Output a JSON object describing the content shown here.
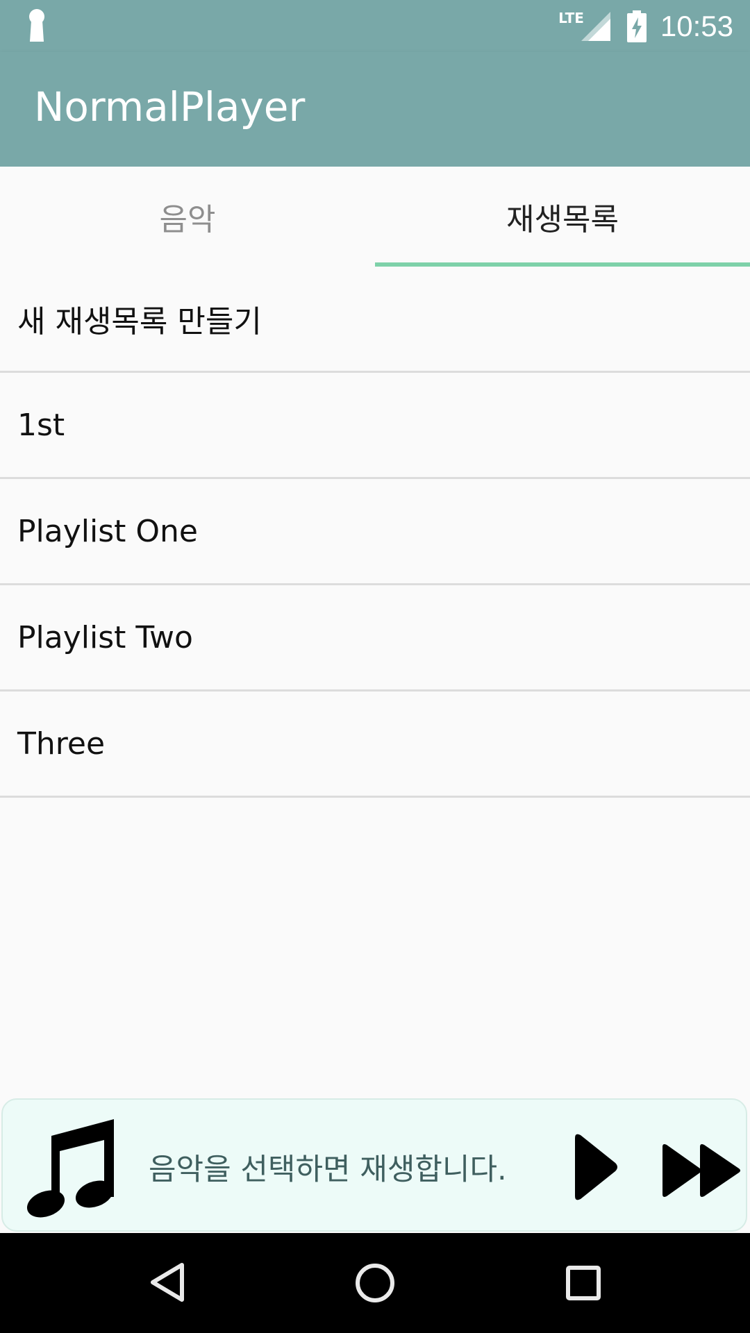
{
  "status_bar": {
    "time": "10:53",
    "network": "LTE",
    "icons": [
      "keyhole-icon",
      "signal-icon",
      "battery-charging-icon"
    ]
  },
  "app_bar": {
    "title": "NormalPlayer"
  },
  "tabs": [
    {
      "label": "음악",
      "active": false
    },
    {
      "label": "재생목록",
      "active": true
    }
  ],
  "playlists": [
    {
      "label": "새 재생목록 만들기"
    },
    {
      "label": "1st"
    },
    {
      "label": "Playlist One"
    },
    {
      "label": "Playlist Two"
    },
    {
      "label": "Three"
    }
  ],
  "player": {
    "message": "음악을 선택하면 재생합니다.",
    "icons": [
      "music-note-icon",
      "play-icon",
      "fast-forward-icon"
    ]
  },
  "nav_bar": {
    "icons": [
      "back-icon",
      "home-icon",
      "recents-icon"
    ]
  },
  "colors": {
    "app_bar": "#79a8a8",
    "tab_indicator": "#7ed1a9",
    "player_bg": "#edfbf8",
    "nav_bar": "#000000"
  }
}
